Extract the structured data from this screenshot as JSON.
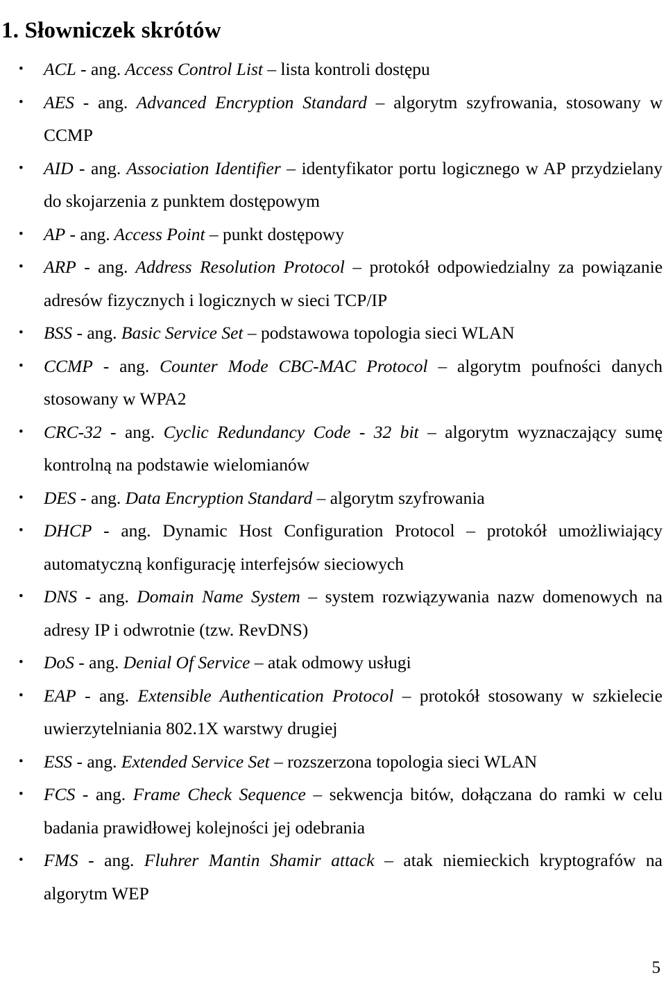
{
  "document": {
    "heading": "1. Słowniczek skrótów",
    "page_number": "5",
    "bullet_glyph": "•",
    "separator_abbr": " - ",
    "lang_marker": "ang.",
    "separator_def": " – ",
    "text_color": "#000000",
    "background_color": "#ffffff"
  },
  "entries": [
    {
      "abbr": "ACL",
      "sep1": " - ",
      "ang": "ang.",
      "expansion": " Access Control List",
      "expansion_italic": true,
      "sep2": " – ",
      "definition": "lista kontroli dostępu"
    },
    {
      "abbr": "AES",
      "sep1": " - ",
      "ang": "ang.",
      "expansion": " Advanced Encryption Standard",
      "expansion_italic": true,
      "sep2": " – ",
      "definition": "algorytm szyfrowania, stosowany w CCMP"
    },
    {
      "abbr": "AID",
      "sep1": " - ",
      "ang": "ang.",
      "expansion": " Association Identifier",
      "expansion_italic": true,
      "sep2": " – ",
      "definition": "identyfikator portu logicznego w AP przydzielany do skojarzenia z punktem dostępowym"
    },
    {
      "abbr": "AP",
      "sep1": " - ",
      "ang": "ang.",
      "expansion": " Access Point",
      "expansion_italic": true,
      "sep2": " – ",
      "definition": "punkt dostępowy"
    },
    {
      "abbr": "ARP",
      "sep1": " - ",
      "ang": "ang.",
      "expansion": " Address Resolution Protocol",
      "expansion_italic": true,
      "sep2": " – ",
      "definition": "protokół odpowiedzialny za powiązanie adresów fizycznych i logicznych w sieci TCP/IP"
    },
    {
      "abbr": "BSS",
      "sep1": " - ",
      "ang": "ang.",
      "expansion": " Basic Service Set",
      "expansion_italic": true,
      "sep2": " – ",
      "definition": "podstawowa topologia sieci WLAN"
    },
    {
      "abbr": "CCMP",
      "sep1": " - ",
      "ang": "ang.",
      "expansion": " Counter Mode CBC-MAC Protocol",
      "expansion_italic": true,
      "sep2": " – ",
      "definition": "algorytm poufności danych stosowany w WPA2"
    },
    {
      "abbr": "CRC-32",
      "sep1": " - ",
      "ang": "ang.",
      "expansion": " Cyclic Redundancy Code - 32 bit",
      "expansion_italic": true,
      "sep2": " – ",
      "definition": "algorytm wyznaczający sumę kontrolną na podstawie wielomianów"
    },
    {
      "abbr": "DES",
      "sep1": " - ",
      "ang": "ang.",
      "expansion": " Data Encryption Standard",
      "expansion_italic": true,
      "sep2": " – ",
      "definition": "algorytm szyfrowania"
    },
    {
      "abbr": "DHCP",
      "sep1": " - ",
      "ang": "ang.",
      "expansion": " Dynamic Host Configuration Protocol",
      "expansion_italic": false,
      "sep2": " – ",
      "definition": "protokół umożliwiający automatyczną konfigurację interfejsów sieciowych"
    },
    {
      "abbr": "DNS",
      "sep1": " - ",
      "ang": "ang.",
      "expansion": " Domain Name System",
      "expansion_italic": true,
      "sep2": " – ",
      "definition": "system rozwiązywania nazw domenowych na adresy IP i odwrotnie (tzw. RevDNS)"
    },
    {
      "abbr": "DoS",
      "sep1": " - ",
      "ang": "ang.",
      "expansion": " Denial Of Service",
      "expansion_italic": true,
      "sep2": " – ",
      "definition": "atak odmowy usługi"
    },
    {
      "abbr": "EAP",
      "sep1": " - ",
      "ang": "ang.",
      "expansion": " Extensible Authentication Protocol",
      "expansion_italic": true,
      "sep2": " – ",
      "definition": "protokół stosowany w szkielecie uwierzytelniania 802.1X warstwy drugiej"
    },
    {
      "abbr": "ESS",
      "sep1": " - ",
      "ang": "ang.",
      "expansion": " Extended Service Set",
      "expansion_italic": true,
      "sep2": " – ",
      "definition": "rozszerzona topologia sieci WLAN"
    },
    {
      "abbr": "FCS",
      "sep1": " - ",
      "ang": "ang.",
      "expansion": " Frame Check Sequence",
      "expansion_italic": true,
      "sep2": " – ",
      "definition": "sekwencja bitów, dołączana do ramki w celu badania prawidłowej kolejności jej odebrania"
    },
    {
      "abbr": "FMS",
      "sep1": " - ",
      "ang": "ang.",
      "expansion": " Fluhrer Mantin Shamir attack",
      "expansion_italic": true,
      "sep2": " – ",
      "definition": "atak niemieckich kryptografów na algorytm WEP"
    }
  ]
}
